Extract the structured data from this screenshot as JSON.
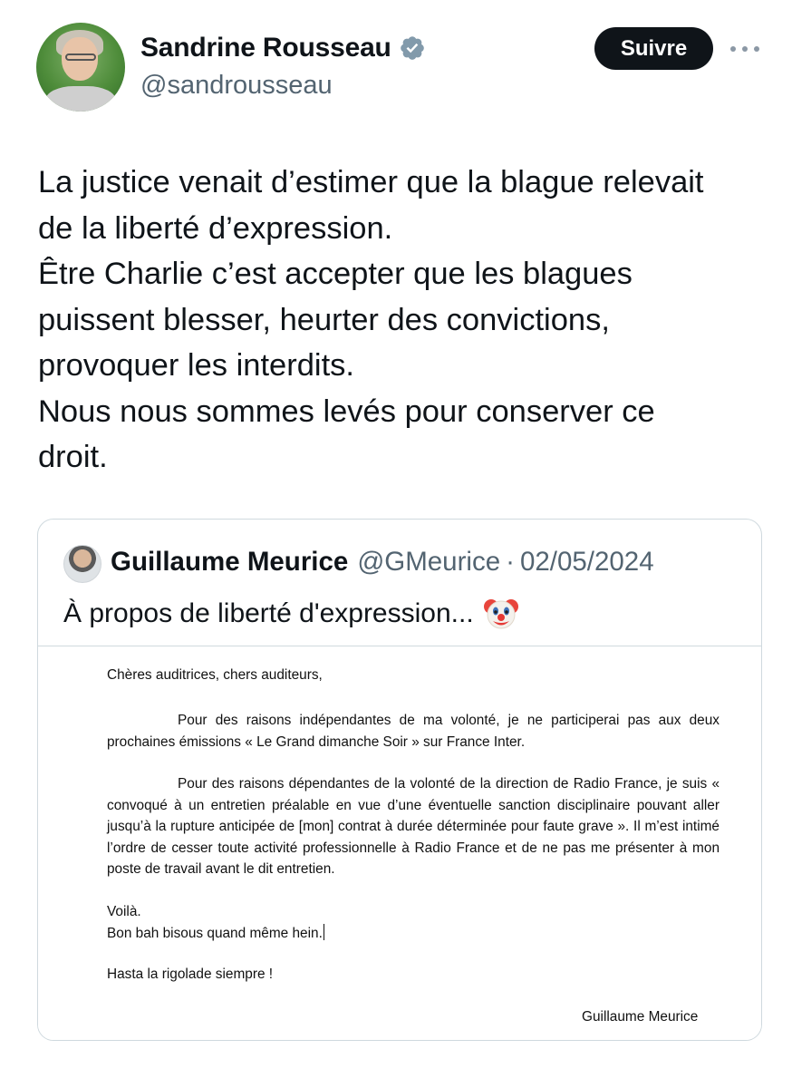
{
  "author": {
    "display_name": "Sandrine Rousseau",
    "handle": "@sandrousseau",
    "avatar_icon": "profile-photo",
    "verified_icon": "verified-badge-icon"
  },
  "actions": {
    "follow_label": "Suivre",
    "more_icon": "more-options-icon"
  },
  "tweet": {
    "lines": [
      "La justice venait d’estimer que la blague relevait",
      "de la liberté d’expression.",
      "Être Charlie c’est accepter que les blagues",
      "puissent blesser, heurter des convictions,",
      "provoquer les interdits.",
      "Nous nous sommes levés pour conserver ce",
      "droit."
    ]
  },
  "quote": {
    "display_name": "Guillaume Meurice",
    "handle": "@GMeurice",
    "separator": "·",
    "date": "02/05/2024",
    "text": "À propos de liberté d'expression...",
    "emoji_icon": "clown-face-icon",
    "letter": {
      "greeting": "Chères auditrices, chers auditeurs,",
      "paragraph1": "Pour des raisons indépendantes de ma volonté, je ne participerai pas aux deux prochaines émissions « Le Grand dimanche Soir » sur France Inter.",
      "paragraph2": "Pour des raisons dépendantes de la volonté de la direction de Radio France, je suis « convoqué à un entretien préalable en vue d’une éventuelle sanction disciplinaire pouvant aller jusqu’à la rupture anticipée de [mon] contrat à durée déterminée pour faute grave ». Il m’est intimé l’ordre de cesser toute activité professionnelle à Radio France et de ne pas me présenter à mon poste de travail avant le dit entretien.",
      "line_voila": "Voilà.",
      "line_bisous": "Bon bah bisous quand même hein.",
      "closing": "Hasta la rigolade siempre !",
      "signature": "Guillaume Meurice"
    }
  },
  "colors": {
    "text_primary": "#0f1419",
    "text_secondary": "#536471",
    "verified_blue": "#829aab",
    "border": "#cfd9de",
    "button_bg": "#0f1419"
  }
}
